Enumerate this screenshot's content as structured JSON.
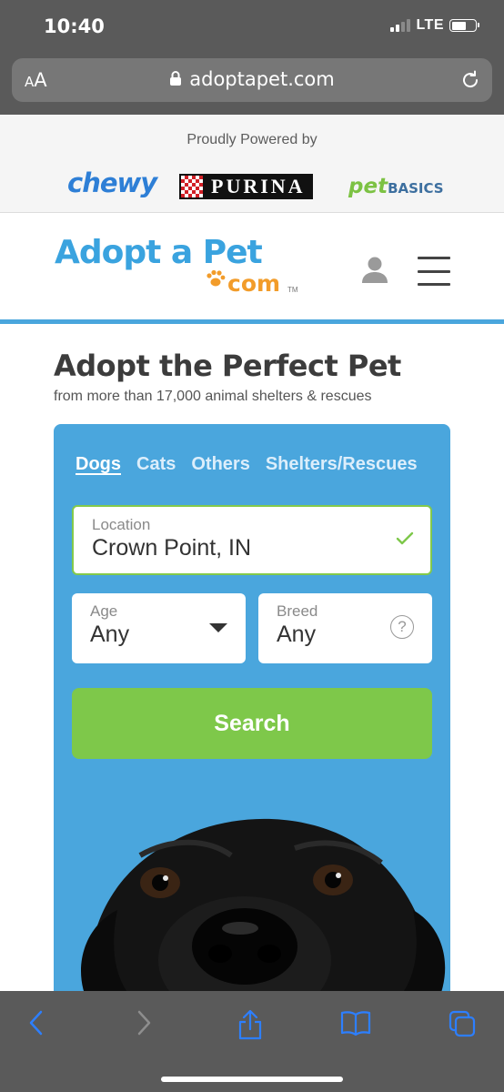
{
  "status_bar": {
    "time": "10:40",
    "network": "LTE"
  },
  "browser": {
    "text_size_label_small": "A",
    "text_size_label_large": "A",
    "url": "adoptapet.com"
  },
  "sponsors": {
    "powered_by": "Proudly Powered by",
    "brands": [
      "chewy",
      "PURINA",
      "pet",
      "BASICS"
    ]
  },
  "site": {
    "logo_main": "Adopt a Pet",
    "logo_com": "com",
    "logo_tm": "TM"
  },
  "hero": {
    "title": "Adopt the Perfect Pet",
    "subtitle": "from more than 17,000 animal shelters & rescues"
  },
  "search": {
    "tabs": [
      {
        "label": "Dogs",
        "active": true
      },
      {
        "label": "Cats",
        "active": false
      },
      {
        "label": "Others",
        "active": false
      },
      {
        "label": "Shelters/Rescues",
        "active": false
      }
    ],
    "location": {
      "label": "Location",
      "value": "Crown Point, IN"
    },
    "age": {
      "label": "Age",
      "value": "Any"
    },
    "breed": {
      "label": "Breed",
      "value": "Any",
      "help": "?"
    },
    "button": "Search"
  },
  "colors": {
    "brand_blue": "#4aa6dd",
    "brand_green": "#7ec84a",
    "logo_orange": "#f29c2a",
    "chewy_blue": "#2e7fd6"
  }
}
